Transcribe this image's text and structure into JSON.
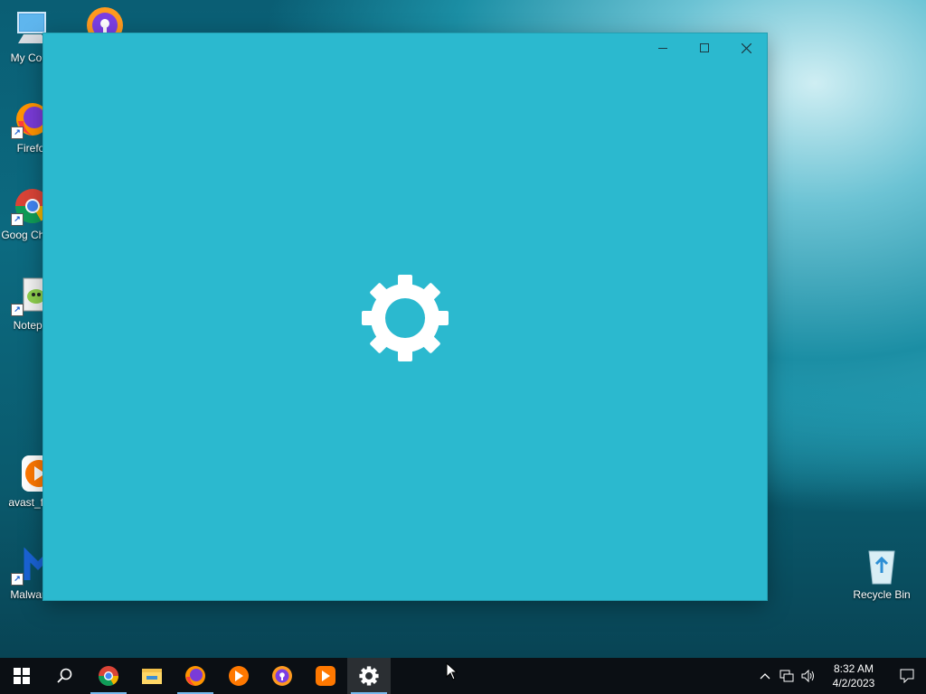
{
  "desktop": {
    "icons": [
      {
        "label": "My Com"
      },
      {
        "label": "Firefo"
      },
      {
        "label": "Goog Chron"
      },
      {
        "label": "Notepa"
      },
      {
        "label": "avast_fre"
      },
      {
        "label": "Malware"
      },
      {
        "label": "Recycle Bin"
      }
    ]
  },
  "window": {
    "controls": {
      "minimize": "minimize",
      "maximize": "maximize",
      "close": "close"
    },
    "splash_icon": "gear-icon"
  },
  "taskbar": {
    "items": [
      "start",
      "search",
      "chrome",
      "file-explorer",
      "firefox",
      "avast",
      "avast-secure-browser",
      "avast-alt",
      "settings"
    ],
    "clock": {
      "time": "8:32 AM",
      "date": "4/2/2023"
    }
  },
  "colors": {
    "window_bg": "#2bb9cf",
    "taskbar_bg": "#0b0f14",
    "accent": "#76b9ed"
  }
}
